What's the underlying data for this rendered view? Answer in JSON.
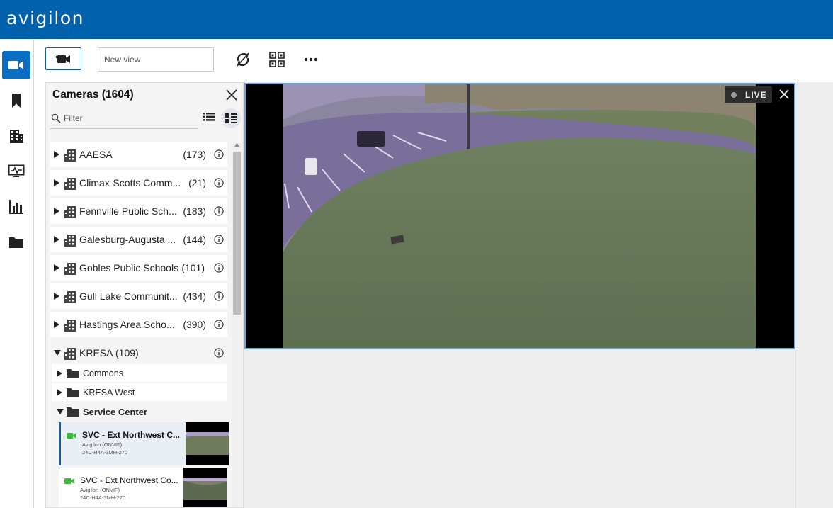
{
  "app": {
    "brand": "avigilon",
    "accent_color": "#0061ac"
  },
  "rail": {
    "items": [
      {
        "name": "camera-icon",
        "active": true
      },
      {
        "name": "bookmark-icon"
      },
      {
        "name": "building-icon"
      },
      {
        "name": "monitor-icon"
      },
      {
        "name": "chart-icon"
      },
      {
        "name": "folder-icon"
      }
    ]
  },
  "toolbar": {
    "view_name_placeholder": "New view",
    "icons": [
      "camera-icon",
      "sync-icon",
      "qr-code-icon",
      "more-icon"
    ]
  },
  "panel": {
    "title": "Cameras (1604)",
    "filter_placeholder": "Filter",
    "sites": [
      {
        "name": "AAESA",
        "count": "(173)"
      },
      {
        "name": "Climax-Scotts Comm...",
        "count": "(21)"
      },
      {
        "name": "Fennville Public Sch...",
        "count": "(183)"
      },
      {
        "name": "Galesburg-Augusta ...",
        "count": "(144)"
      },
      {
        "name": "Gobles Public Schools",
        "count": "(101)"
      },
      {
        "name": "Gull Lake Communit...",
        "count": "(434)"
      },
      {
        "name": "Hastings Area Scho...",
        "count": "(390)"
      },
      {
        "name": "KRESA",
        "count": "(109)"
      }
    ],
    "folders": [
      {
        "name": "Commons"
      },
      {
        "name": "KRESA West"
      },
      {
        "name": "Service Center"
      }
    ],
    "cameras": [
      {
        "name": "SVC - Ext Northwest C...",
        "vendor": "Avigilon (ONVIF)",
        "model": "24C-H4A-3MH-270",
        "selected": true
      },
      {
        "name": "SVC - Ext Northwest Co...",
        "vendor": "Avigilon (ONVIF)",
        "model": "24C-H4A-3MH-270",
        "selected": false
      }
    ]
  },
  "tile": {
    "live_label": "LIVE",
    "status_color": "#999999",
    "border_color": "#6ca6e2"
  }
}
